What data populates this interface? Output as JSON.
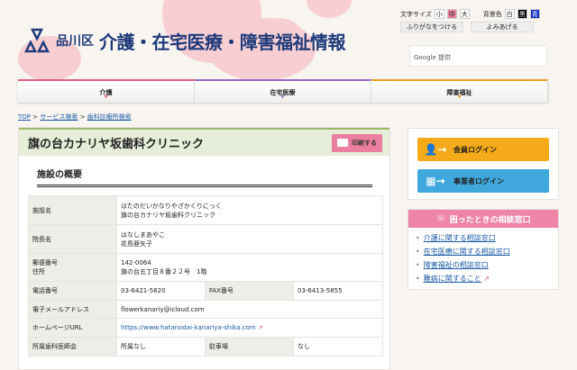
{
  "header": {
    "ward": "品川区",
    "title": "介護・在宅医療・障害福祉情報",
    "font_size_label": "文字サイズ",
    "font_sizes": [
      "小",
      "中",
      "大"
    ],
    "bg_color_label": "背景色",
    "bg_colors": [
      "白",
      "黒",
      "青"
    ],
    "furigana_button": "ふりがなをつける",
    "read_aloud_button": "よみあげる",
    "search_placeholder": "Google 提供"
  },
  "nav": [
    {
      "label": "介護",
      "color": "#e0607e"
    },
    {
      "label": "在宅医療",
      "color": "#9a6cc8"
    },
    {
      "label": "障害福祉",
      "color": "#e8a020"
    }
  ],
  "breadcrumb": [
    "TOP",
    "サービス検索",
    "歯科診療所検索"
  ],
  "main": {
    "title": "旗の台カナリヤ坂歯科クリニック",
    "print_button": "印刷する",
    "section_title": "施設の概要",
    "rows": {
      "name_label": "施設名",
      "name_kana": "はたのだいかなりやざかくりにっく",
      "name": "旗の台カナリヤ坂歯科クリニック",
      "director_label": "院長名",
      "director_kana": "はなしまあやこ",
      "director": "花島亜矢子",
      "postal_label": "郵便番号",
      "address_label": "住所",
      "postal": "142-0064",
      "address": "旗の台五丁目８番２２号　1階",
      "phone_label": "電話番号",
      "phone": "03-6421-5620",
      "fax_label": "FAX番号",
      "fax": "03-6413-5855",
      "email_label": "電子メールアドレス",
      "email": "flowerkanariy@icloud.com",
      "url_label": "ホームページURL",
      "url": "https://www.hatanodai-kanariya-shika.com",
      "assoc_label": "所属歯科医師会",
      "assoc": "所属なし",
      "parking_label": "駐車場",
      "parking": "なし"
    }
  },
  "sidebar": {
    "member_login": "会員ログイン",
    "business_login": "事業者ログイン",
    "consult_title": "困ったときの相談窓口",
    "consult_links": [
      "介護に関する相談窓口",
      "在宅医療に関する相談窓口",
      "障害福祉の相談窓口",
      "難病に関すること"
    ]
  }
}
